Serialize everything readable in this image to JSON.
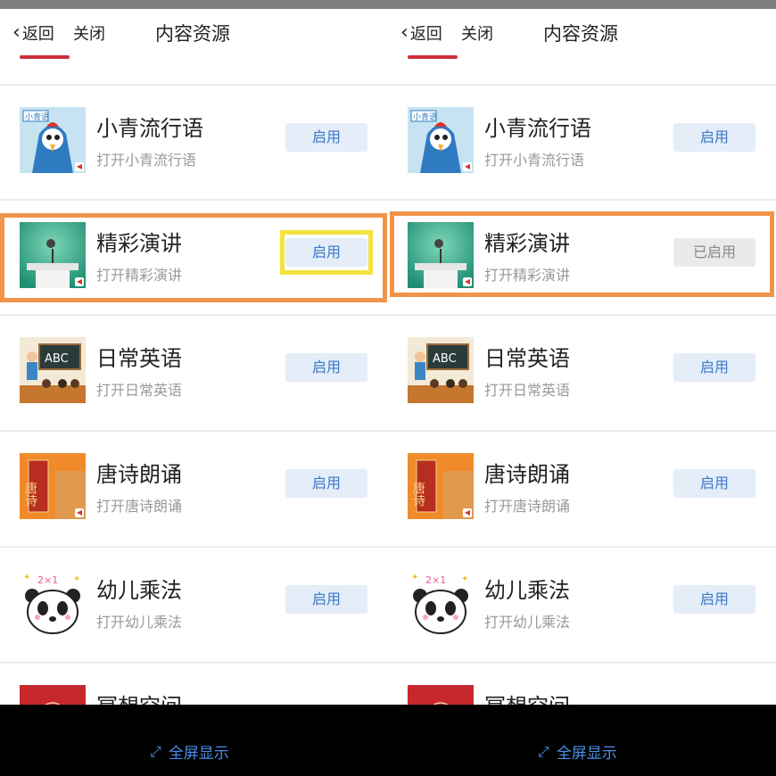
{
  "nav": {
    "back_label": "返回",
    "close_label": "关闭",
    "title": "内容资源"
  },
  "items": [
    {
      "name": "小青流行语",
      "subtitle": "打开小青流行语",
      "icon": "cartoon-chicken-icon",
      "left_button": "启用",
      "right_button": "启用"
    },
    {
      "name": "精彩演讲",
      "subtitle": "打开精彩演讲",
      "icon": "podium-microphone-icon",
      "left_button": "启用",
      "right_button": "已启用"
    },
    {
      "name": "日常英语",
      "subtitle": "打开日常英语",
      "icon": "classroom-abc-icon",
      "left_button": "启用",
      "right_button": "启用"
    },
    {
      "name": "唐诗朗诵",
      "subtitle": "打开唐诗朗诵",
      "icon": "tang-poetry-icon",
      "left_button": "启用",
      "right_button": "启用"
    },
    {
      "name": "幼儿乘法",
      "subtitle": "打开幼儿乘法",
      "icon": "panda-multiplication-icon",
      "left_button": "启用",
      "right_button": "启用"
    },
    {
      "name": "冥想空间",
      "subtitle": "",
      "icon": "meditation-mandala-icon",
      "left_button": "",
      "right_button": ""
    }
  ],
  "thumb_labels": {
    "chicken_tag": "小青语",
    "abc": "ABC",
    "tang_poem": "唐诗",
    "mult": "2×1"
  },
  "footer": {
    "fullscreen_label": "全屏显示"
  },
  "colors": {
    "highlight_orange": "#f0944a",
    "highlight_yellow": "#f4e23e",
    "button_blue": "#3d77c7",
    "accent_red": "#cf3038"
  }
}
